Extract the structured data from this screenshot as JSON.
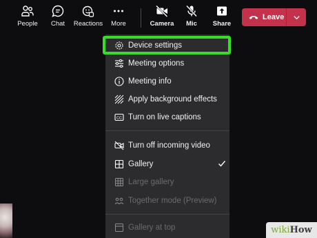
{
  "toolbar": {
    "people": "People",
    "chat": "Chat",
    "reactions": "Reactions",
    "more": "More",
    "camera": "Camera",
    "mic": "Mic",
    "share": "Share",
    "leave": "Leave"
  },
  "menu": {
    "items": [
      {
        "label": "Device settings",
        "icon": "gear-icon",
        "state": "highlighted"
      },
      {
        "label": "Meeting options",
        "icon": "sliders-icon"
      },
      {
        "label": "Meeting info",
        "icon": "info-icon"
      },
      {
        "label": "Apply background effects",
        "icon": "background-effects-icon"
      },
      {
        "label": "Turn on live captions",
        "icon": "cc-icon"
      },
      {
        "label": "Turn off incoming video",
        "icon": "video-off-icon"
      },
      {
        "label": "Gallery",
        "icon": "gallery-icon",
        "checked": true
      },
      {
        "label": "Large gallery",
        "icon": "large-gallery-icon",
        "disabled": true
      },
      {
        "label": "Together mode (Preview)",
        "icon": "together-mode-icon",
        "disabled": true
      },
      {
        "label": "Gallery at top",
        "icon": "gallery-top-icon",
        "disabled": true
      }
    ]
  },
  "watermark": {
    "part1": "wiki",
    "part2": "How"
  },
  "colors": {
    "highlight": "#33e022",
    "leave": "#c4314b",
    "menu_bg": "#2c2c2e"
  }
}
